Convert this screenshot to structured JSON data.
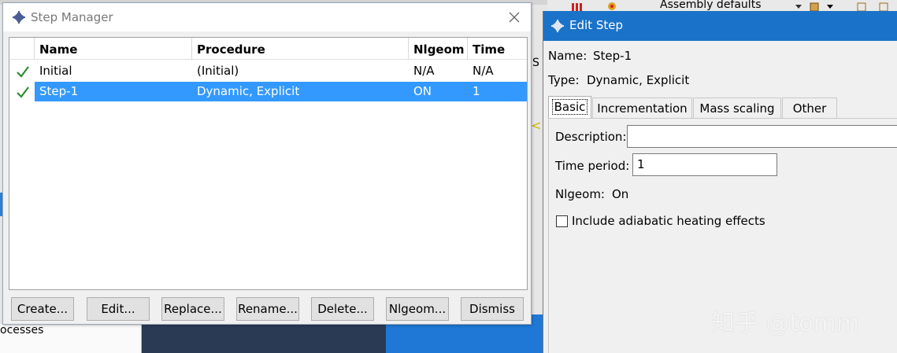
{
  "background": {
    "left_panel_text": "ocesses",
    "toolbar_assembly_label": "Assembly defaults",
    "side_tab_letter": "S",
    "viewport_marker": "<"
  },
  "step_manager": {
    "title": "Step Manager",
    "columns": [
      "Name",
      "Procedure",
      "Nlgeom",
      "Time"
    ],
    "rows": [
      {
        "name": "Initial",
        "procedure": "(Initial)",
        "nlgeom": "N/A",
        "time": "N/A",
        "selected": false
      },
      {
        "name": "Step-1",
        "procedure": "Dynamic, Explicit",
        "nlgeom": "ON",
        "time": "1",
        "selected": true
      }
    ],
    "buttons": {
      "create": "Create...",
      "edit": "Edit...",
      "replace": "Replace...",
      "rename": "Rename...",
      "delete": "Delete...",
      "nlgeom": "Nlgeom...",
      "dismiss": "Dismiss"
    }
  },
  "edit_step": {
    "title": "Edit Step",
    "name_label": "Name:",
    "name_value": "Step-1",
    "type_label": "Type:",
    "type_value": "Dynamic, Explicit",
    "tabs": [
      "Basic",
      "Incrementation",
      "Mass scaling",
      "Other"
    ],
    "active_tab": "Basic",
    "basic": {
      "description_label": "Description:",
      "description_value": "",
      "time_period_label": "Time period:",
      "time_period_value": "1",
      "nlgeom_label": "Nlgeom:",
      "nlgeom_value": "On",
      "adiabatic_label": "Include adiabatic heating effects",
      "adiabatic_checked": false
    }
  },
  "watermark": "知乎 @tomm",
  "colors": {
    "selection": "#3399ff",
    "edit_titlebar": "#1a73c8",
    "check_green": "#2e8b2e"
  }
}
